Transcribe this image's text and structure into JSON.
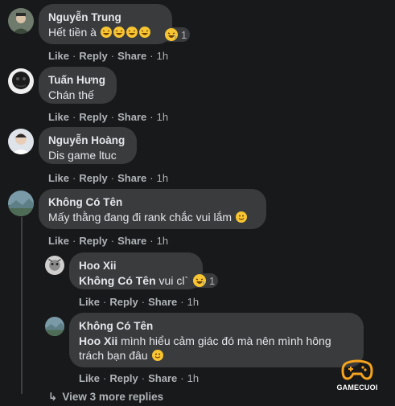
{
  "comments": [
    {
      "author": "Nguyễn Trung",
      "text": "Hết tiền à",
      "emojis": [
        "laugh-emoji",
        "laugh-emoji",
        "laugh-emoji",
        "laugh-emoji"
      ],
      "reaction": {
        "icon": "haha-reaction-icon",
        "count": "1"
      },
      "actions": {
        "like": "Like",
        "reply": "Reply",
        "share": "Share",
        "time": "1h"
      }
    },
    {
      "author": "Tuấn Hưng",
      "text": "Chán thế",
      "actions": {
        "like": "Like",
        "reply": "Reply",
        "share": "Share",
        "time": "1h"
      }
    },
    {
      "author": "Nguyễn Hoàng",
      "text": "Dis game ltuc",
      "actions": {
        "like": "Like",
        "reply": "Reply",
        "share": "Share",
        "time": "1h"
      }
    },
    {
      "author": "Không Có Tên",
      "text": "Mấy thằng đang đi rank chắc vui lắm",
      "emojis": [
        "smile-emoji"
      ],
      "actions": {
        "like": "Like",
        "reply": "Reply",
        "share": "Share",
        "time": "1h"
      }
    }
  ],
  "replies": [
    {
      "author": "Hoo Xii",
      "mention": "Không Có Tên",
      "text": "vui cl`",
      "reaction": {
        "icon": "haha-reaction-icon",
        "count": "1"
      },
      "actions": {
        "like": "Like",
        "reply": "Reply",
        "share": "Share",
        "time": "1h"
      }
    },
    {
      "author": "Không Có Tên",
      "mention": "Hoo Xii",
      "text_line1": "mình hiểu cảm giác đó mà nên mình hông",
      "text_line2": "trách bạn đâu",
      "emojis": [
        "smile-emoji"
      ],
      "actions": {
        "like": "Like",
        "reply": "Reply",
        "share": "Share",
        "time": "1h"
      }
    }
  ],
  "view_more": "View 3 more replies",
  "watermark": {
    "name": "GAMECUOI",
    "icon": "gamepad-icon",
    "color": "#f7a41d"
  },
  "colors": {
    "background": "#18191a",
    "bubble": "#3a3b3c",
    "secondary_text": "#b0b3b8",
    "emoji_yellow": "#f7c532"
  }
}
